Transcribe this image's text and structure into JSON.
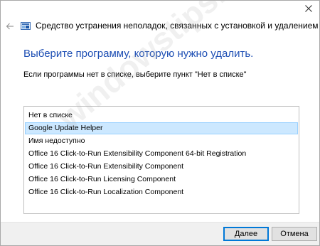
{
  "header": {
    "title": "Средство устранения неполадок, связанных с установкой и удалением программы",
    "back_icon": "back-arrow-icon",
    "app_icon": "troubleshooter-icon",
    "close_icon": "close-icon"
  },
  "main": {
    "heading": "Выберите программу, которую нужно удалить.",
    "instruction": "Если программы нет в списке, выберите пункт \"Нет в списке\"",
    "programs": [
      "Нет в списке",
      "Google Update Helper",
      "Имя недоступно",
      "Office 16 Click-to-Run Extensibility Component 64-bit Registration",
      "Office 16 Click-to-Run Extensibility Component",
      "Office 16 Click-to-Run Licensing Component",
      "Office 16 Click-to-Run Localization Component"
    ],
    "selected_program": "Google Update Helper"
  },
  "footer": {
    "next_label": "Далее",
    "cancel_label": "Отмена"
  },
  "watermark": "windowstips.ru",
  "colors": {
    "heading": "#1e4fb4",
    "selection": "#cce8ff",
    "primary_border": "#0078d7"
  }
}
